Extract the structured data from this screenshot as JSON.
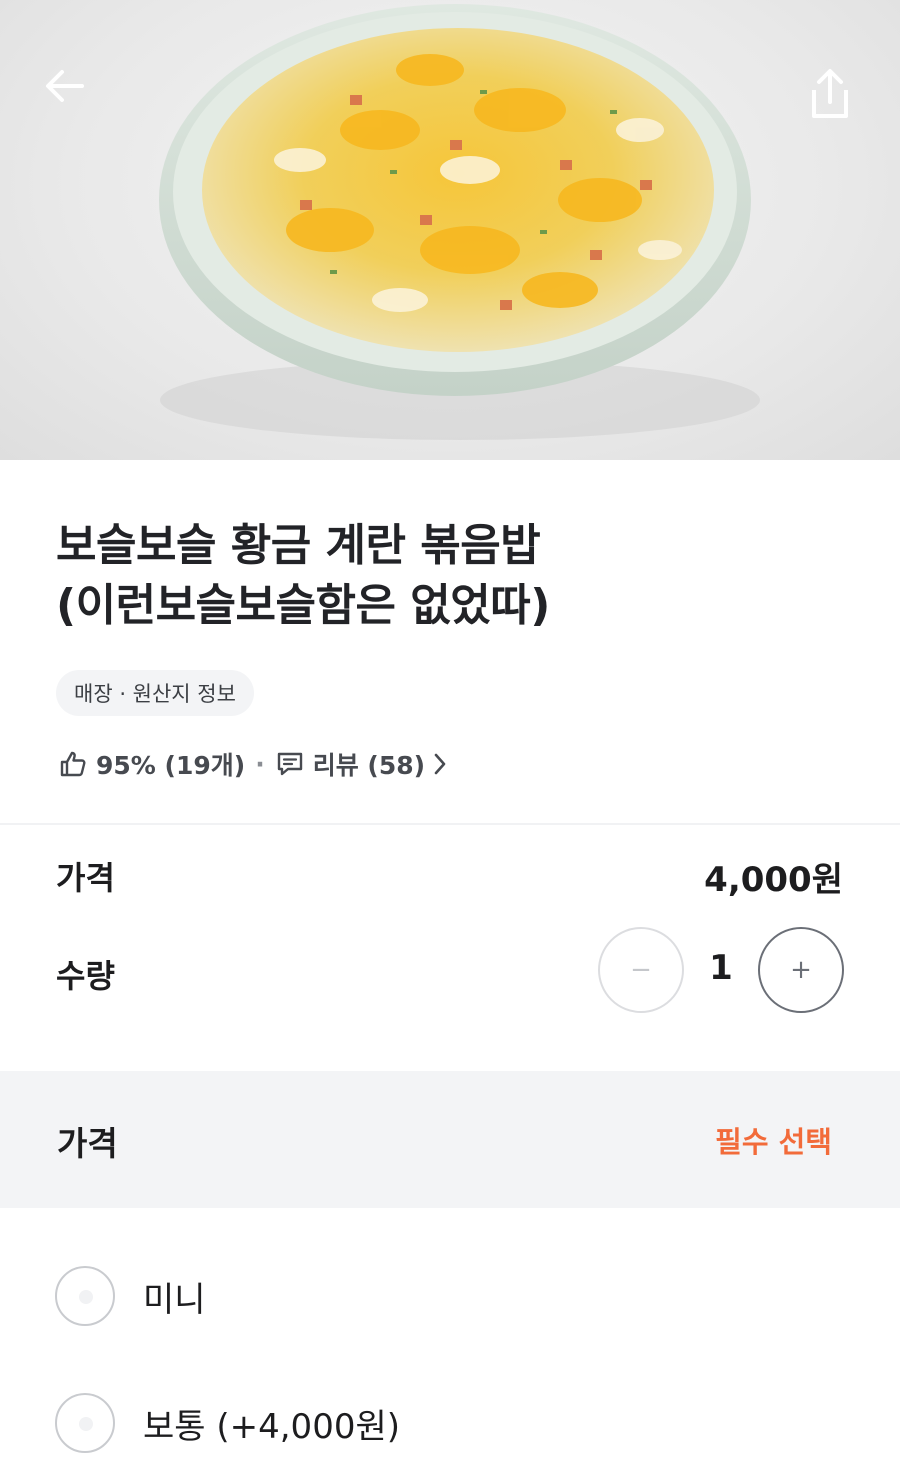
{
  "header": {
    "back_icon": "arrow-left-icon",
    "share_icon": "share-icon"
  },
  "product": {
    "title_line1": "보슬보슬 황금 계란 볶음밥",
    "title_line2": "(이런보슬보슬함은 없었따)",
    "info_chip": "매장 · 원산지 정보",
    "like_icon": "thumbs-up-icon",
    "like_stat": "95% (19개)",
    "separator": "·",
    "review_icon": "comment-icon",
    "review_label": "리뷰 (58)",
    "review_chevron": "chevron-right-icon"
  },
  "order": {
    "price_label": "가격",
    "price_value": "4,000원",
    "quantity_label": "수량",
    "quantity_minus": "−",
    "quantity_value": "1",
    "quantity_plus": "+"
  },
  "options": {
    "title": "가격",
    "required_label": "필수 선택",
    "items": [
      {
        "label": "미니",
        "selected": false
      },
      {
        "label": "보통 (+4,000원)",
        "selected": false
      }
    ]
  },
  "colors": {
    "accent": "#f26b3a",
    "section_bg": "#f3f4f6"
  }
}
